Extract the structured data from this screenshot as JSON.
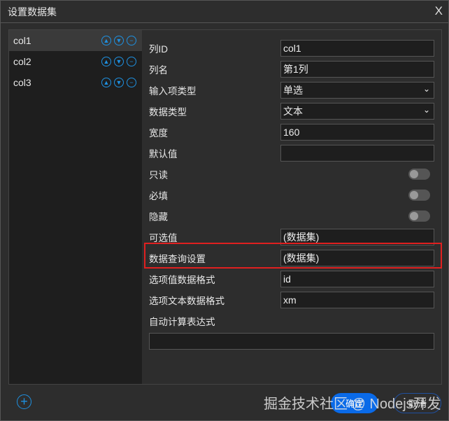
{
  "title": "设置数据集",
  "close": "X",
  "columns": [
    {
      "label": "col1"
    },
    {
      "label": "col2"
    },
    {
      "label": "col3"
    }
  ],
  "icons": {
    "up": "⌃",
    "down": "⌄",
    "remove": "−"
  },
  "fields": {
    "col_id": {
      "label": "列ID",
      "value": "col1"
    },
    "col_name": {
      "label": "列名",
      "value": "第1列"
    },
    "input_type": {
      "label": "输入项类型",
      "value": "单选"
    },
    "data_type": {
      "label": "数据类型",
      "value": "文本"
    },
    "width": {
      "label": "宽度",
      "value": "160"
    },
    "default": {
      "label": "默认值",
      "value": ""
    },
    "readonly": {
      "label": "只读",
      "on": false
    },
    "required": {
      "label": "必填",
      "on": false
    },
    "hidden": {
      "label": "隐藏",
      "on": false
    },
    "options": {
      "label": "可选值",
      "value": "(数据集)"
    },
    "query": {
      "label": "数据查询设置",
      "value": "(数据集)"
    },
    "option_value_fmt": {
      "label": "选项值数据格式",
      "value": "id"
    },
    "option_text_fmt": {
      "label": "选项文本数据格式",
      "value": "xm"
    },
    "expr": {
      "label": "自动计算表达式",
      "value": ""
    }
  },
  "buttons": {
    "ok": "确定",
    "cancel": "取消",
    "add": "+"
  },
  "watermark": "掘金技术社区 @ Nodejs开发"
}
